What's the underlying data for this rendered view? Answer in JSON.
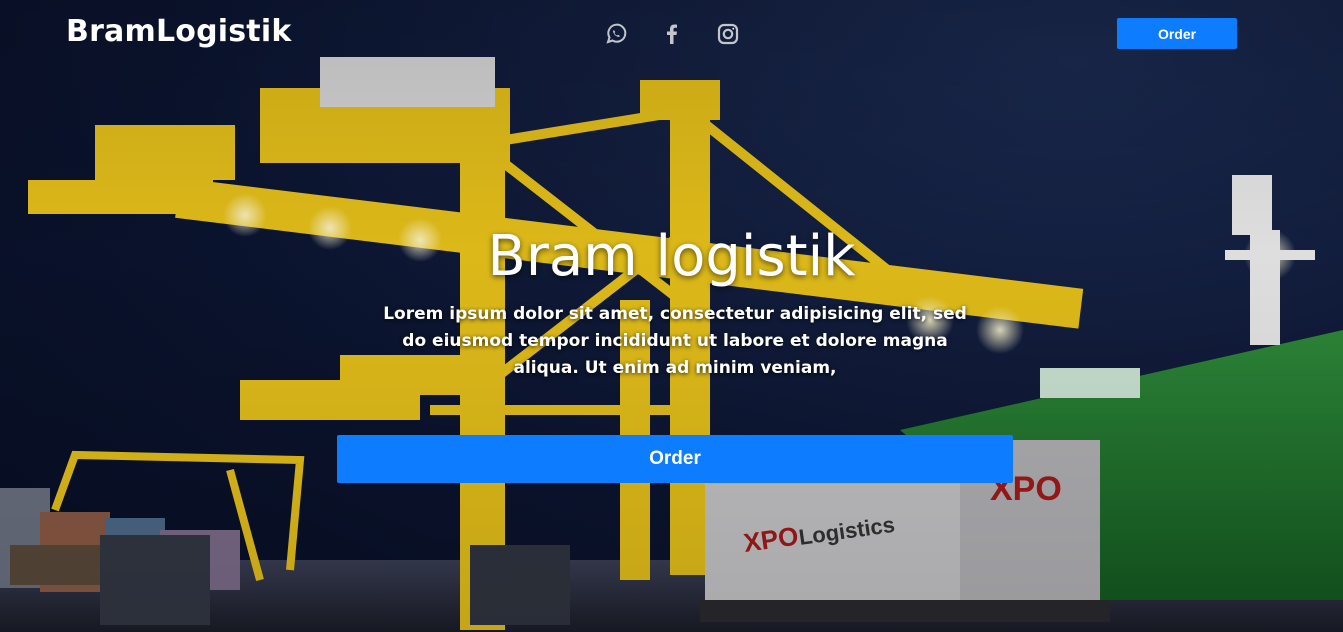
{
  "header": {
    "brand": "BramLogistik",
    "social_icons": [
      "whatsapp-icon",
      "facebook-icon",
      "instagram-icon"
    ],
    "order_label": "Order"
  },
  "hero": {
    "title": "Bram logistik",
    "description": "Lorem ipsum dolor sit amet, consectetur adipisicing elit, sed do eiusmod tempor incididunt ut labore et dolore magna aliqua. Ut enim ad minim veniam,",
    "cta_label": "Order",
    "background_image": "night container port with yellow gantry cranes, green ship hull and XPO Logistics container truck",
    "truck_text": "XPO Logistics"
  },
  "colors": {
    "accent": "#0d7cff",
    "text": "#ffffff",
    "sky": "#0b1430",
    "crane": "#e8c21a",
    "ship": "#1f7a2e"
  }
}
